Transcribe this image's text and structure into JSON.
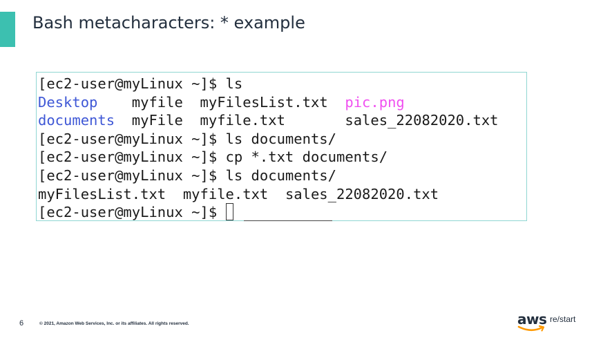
{
  "slide": {
    "title": "Bash metacharacters: * example",
    "page_number": "6",
    "copyright": "© 2021, Amazon Web Services, Inc. or its affiliates. All rights reserved.",
    "logo_aws": "aws",
    "logo_restart": "re/start"
  },
  "terminal": {
    "prompt": "[ec2-user@myLinux ~]$ ",
    "line1_cmd": "ls",
    "ls_row1": [
      "Desktop",
      "myfile",
      "myFilesList.txt",
      "pic.png"
    ],
    "ls_row2": [
      "documents",
      "myFile",
      "myfile.txt",
      "sales_22082020.txt"
    ],
    "line4_cmd": "ls documents/",
    "line5_cmd": "cp *.txt documents/",
    "line6_cmd": "ls documents/",
    "docs_listing": [
      "myFilesList.txt",
      "myfile.txt",
      "sales_22082020.txt"
    ]
  },
  "colors": {
    "accent": "#3cc0b0",
    "directory": "#3e57d6",
    "image_file": "#f050f0",
    "terminal_border": "#8fd6d2",
    "logo_smile": "#ff9900"
  }
}
